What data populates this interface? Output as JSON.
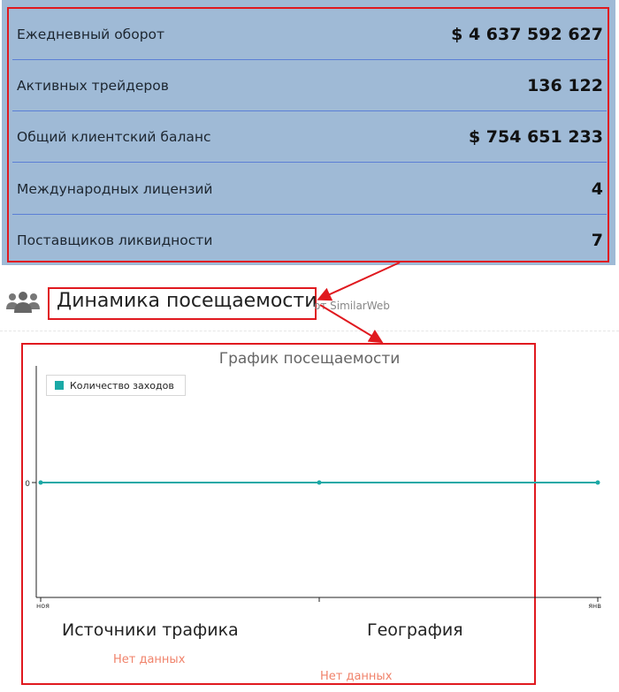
{
  "stats": [
    {
      "label": "Ежедневный оборот",
      "value": "$ 4 637 592 627"
    },
    {
      "label": "Активных трейдеров",
      "value": "136 122"
    },
    {
      "label": "Общий клиентский баланс",
      "value": "$ 754 651 233"
    },
    {
      "label": "Международных лицензий",
      "value": "4"
    },
    {
      "label": "Поставщиков ликвидности",
      "value": "7"
    }
  ],
  "attendance": {
    "heading": "Динамика посещаемости",
    "source": "от SimilarWeb",
    "icon": "people-icon"
  },
  "chart_data": {
    "type": "line",
    "title": "График посещаемости",
    "x": [
      "ноя",
      "",
      "янв"
    ],
    "series": [
      {
        "name": "Количество заходов",
        "values": [
          0,
          0,
          0
        ],
        "color": "#1aa9a6"
      }
    ],
    "ytick_labels": [
      "0"
    ],
    "xtick_labels": [
      "ноя",
      "янв"
    ],
    "legend": "top-left",
    "grid": false
  },
  "traffic": {
    "title": "Источники трафика",
    "empty": "Нет данных"
  },
  "geography": {
    "title": "География",
    "empty": "Нет данных"
  },
  "colors": {
    "table_bg": "#9fbad6",
    "divider": "#5b7fd6",
    "highlight": "#e0191f",
    "series": "#1aa9a6",
    "empty_text": "#f0826a"
  }
}
